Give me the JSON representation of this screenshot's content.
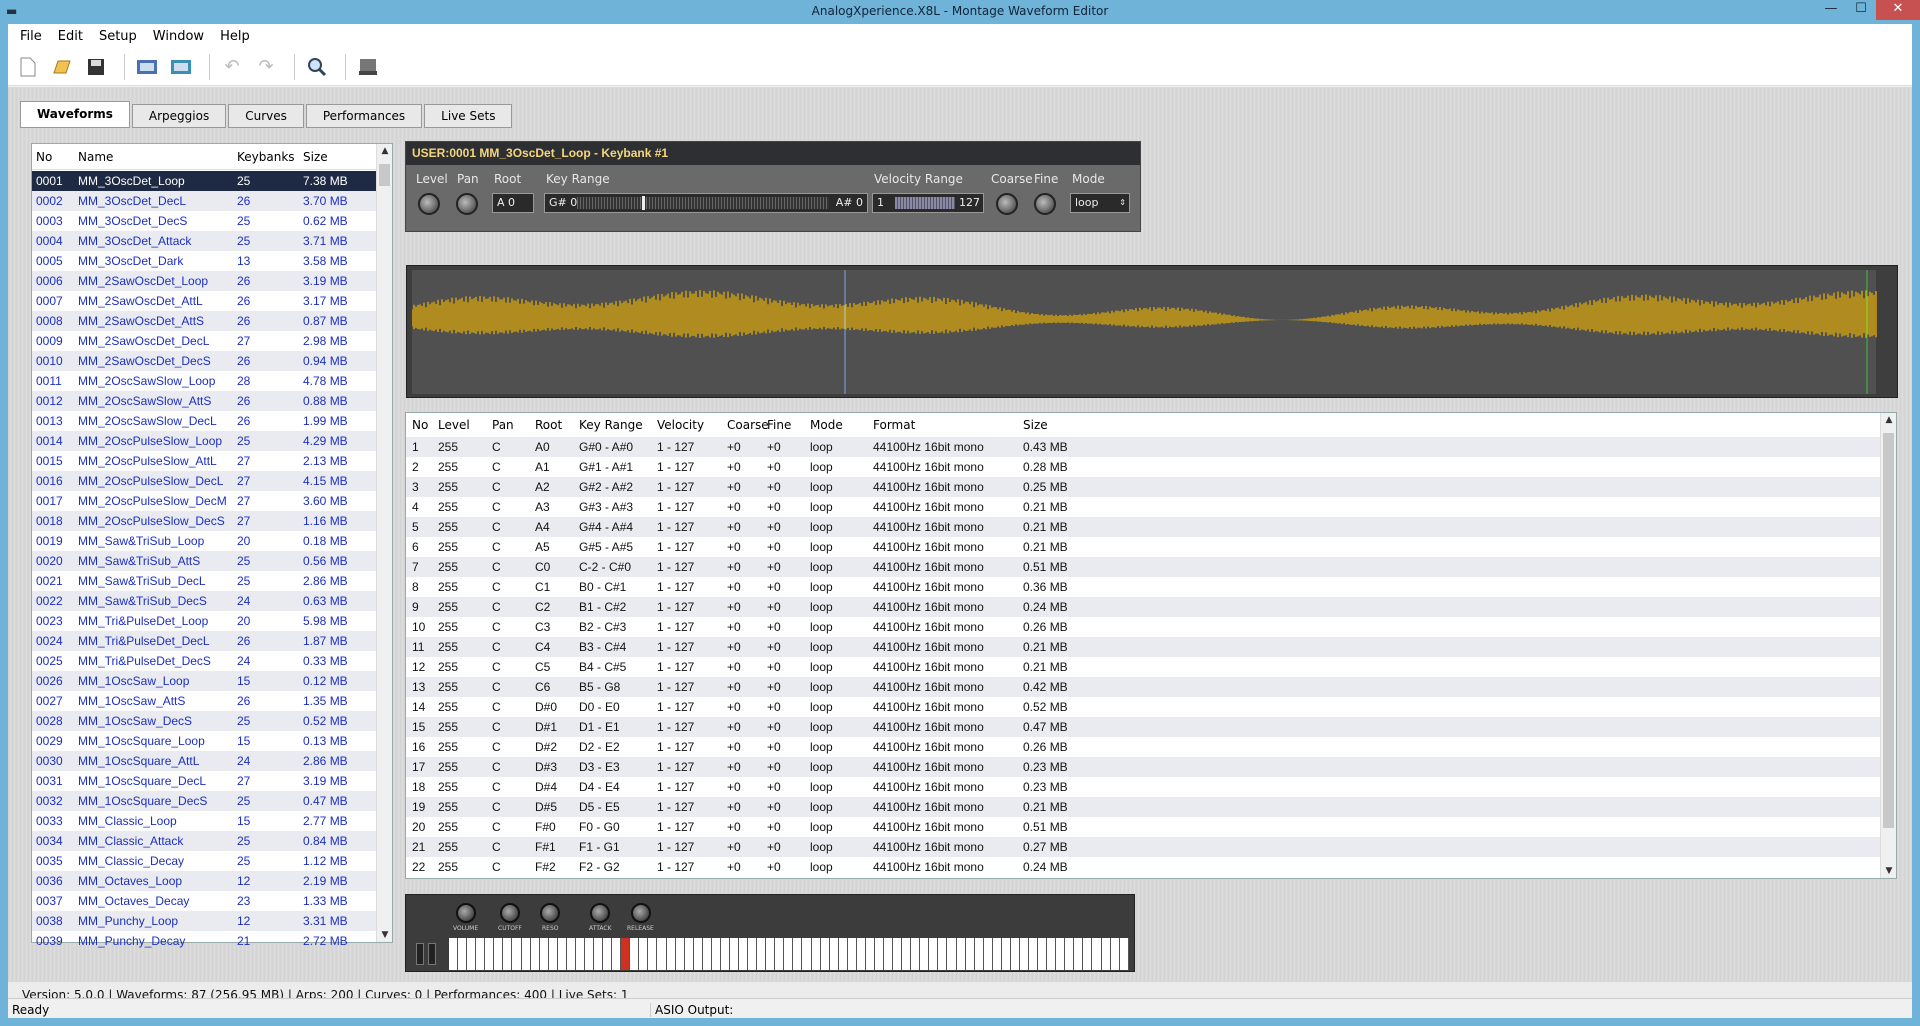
{
  "window": {
    "title": "AnalogXperience.X8L - Montage Waveform Editor",
    "minimize": "—",
    "maximize": "☐",
    "close": "✕"
  },
  "menu": [
    "File",
    "Edit",
    "Setup",
    "Window",
    "Help"
  ],
  "toolbar": {
    "icons": [
      "new-file-icon",
      "open-file-icon",
      "save-icon",
      "import-icon",
      "export-icon",
      "undo-icon",
      "redo-icon",
      "search-icon",
      "device-icon"
    ]
  },
  "tabs": [
    "Waveforms",
    "Arpeggios",
    "Curves",
    "Performances",
    "Live Sets"
  ],
  "waveform_list": {
    "headers": {
      "no": "No",
      "name": "Name",
      "keybanks": "Keybanks",
      "size": "Size"
    },
    "rows": [
      [
        "0001",
        "MM_3OscDet_Loop",
        "25",
        "7.38 MB"
      ],
      [
        "0002",
        "MM_3OscDet_DecL",
        "26",
        "3.70 MB"
      ],
      [
        "0003",
        "MM_3OscDet_DecS",
        "25",
        "0.62 MB"
      ],
      [
        "0004",
        "MM_3OscDet_Attack",
        "25",
        "3.71 MB"
      ],
      [
        "0005",
        "MM_3OscDet_Dark",
        "13",
        "3.58 MB"
      ],
      [
        "0006",
        "MM_2SawOscDet_Loop",
        "26",
        "3.19 MB"
      ],
      [
        "0007",
        "MM_2SawOscDet_AttL",
        "26",
        "3.17 MB"
      ],
      [
        "0008",
        "MM_2SawOscDet_AttS",
        "26",
        "0.87 MB"
      ],
      [
        "0009",
        "MM_2SawOscDet_DecL",
        "27",
        "2.98 MB"
      ],
      [
        "0010",
        "MM_2SawOscDet_DecS",
        "26",
        "0.94 MB"
      ],
      [
        "0011",
        "MM_2OscSawSlow_Loop",
        "28",
        "4.78 MB"
      ],
      [
        "0012",
        "MM_2OscSawSlow_AttS",
        "26",
        "0.88 MB"
      ],
      [
        "0013",
        "MM_2OscSawSlow_DecL",
        "26",
        "1.99 MB"
      ],
      [
        "0014",
        "MM_2OscPulseSlow_Loop",
        "25",
        "4.29 MB"
      ],
      [
        "0015",
        "MM_2OscPulseSlow_AttL",
        "27",
        "2.13 MB"
      ],
      [
        "0016",
        "MM_2OscPulseSlow_DecL",
        "27",
        "4.15 MB"
      ],
      [
        "0017",
        "MM_2OscPulseSlow_DecM",
        "27",
        "3.60 MB"
      ],
      [
        "0018",
        "MM_2OscPulseSlow_DecS",
        "27",
        "1.16 MB"
      ],
      [
        "0019",
        "MM_Saw&TriSub_Loop",
        "20",
        "0.18 MB"
      ],
      [
        "0020",
        "MM_Saw&TriSub_AttS",
        "25",
        "0.56 MB"
      ],
      [
        "0021",
        "MM_Saw&TriSub_DecL",
        "25",
        "2.86 MB"
      ],
      [
        "0022",
        "MM_Saw&TriSub_DecS",
        "24",
        "0.63 MB"
      ],
      [
        "0023",
        "MM_Tri&PulseDet_Loop",
        "20",
        "5.98 MB"
      ],
      [
        "0024",
        "MM_Tri&PulseDet_DecL",
        "26",
        "1.87 MB"
      ],
      [
        "0025",
        "MM_Tri&PulseDet_DecS",
        "24",
        "0.33 MB"
      ],
      [
        "0026",
        "MM_1OscSaw_Loop",
        "15",
        "0.12 MB"
      ],
      [
        "0027",
        "MM_1OscSaw_AttS",
        "26",
        "1.35 MB"
      ],
      [
        "0028",
        "MM_1OscSaw_DecS",
        "25",
        "0.52 MB"
      ],
      [
        "0029",
        "MM_1OscSquare_Loop",
        "15",
        "0.13 MB"
      ],
      [
        "0030",
        "MM_1OscSquare_AttL",
        "24",
        "2.86 MB"
      ],
      [
        "0031",
        "MM_1OscSquare_DecL",
        "27",
        "3.19 MB"
      ],
      [
        "0032",
        "MM_1OscSquare_DecS",
        "25",
        "0.47 MB"
      ],
      [
        "0033",
        "MM_Classic_Loop",
        "15",
        "2.77 MB"
      ],
      [
        "0034",
        "MM_Classic_Attack",
        "25",
        "0.84 MB"
      ],
      [
        "0035",
        "MM_Classic_Decay",
        "25",
        "1.12 MB"
      ],
      [
        "0036",
        "MM_Octaves_Loop",
        "12",
        "2.19 MB"
      ],
      [
        "0037",
        "MM_Octaves_Decay",
        "23",
        "1.33 MB"
      ],
      [
        "0038",
        "MM_Punchy_Loop",
        "12",
        "3.31 MB"
      ],
      [
        "0039",
        "MM_Punchy_Decay",
        "21",
        "2.72 MB"
      ]
    ]
  },
  "keybank_header": {
    "title": "USER:0001 MM_3OscDet_Loop - Keybank #1",
    "labels": {
      "level": "Level",
      "pan": "Pan",
      "root": "Root",
      "key_range": "Key Range",
      "velocity_range": "Velocity Range",
      "coarse": "Coarse",
      "fine": "Fine",
      "mode": "Mode"
    },
    "values": {
      "root": "A 0",
      "key_low": "G# 0",
      "key_high": "A# 0",
      "vel_low": "1",
      "vel_high": "127",
      "mode": "loop"
    }
  },
  "keybank_table": {
    "headers": {
      "no": "No",
      "level": "Level",
      "pan": "Pan",
      "root": "Root",
      "key_range": "Key Range",
      "velocity": "Velocity",
      "coarse": "Coarse",
      "fine": "Fine",
      "mode": "Mode",
      "format": "Format",
      "size": "Size"
    },
    "rows": [
      [
        "1",
        "255",
        "C",
        "A0",
        "G#0 - A#0",
        "1 - 127",
        "+0",
        "+0",
        "loop",
        "44100Hz  16bit  mono",
        "0.43 MB"
      ],
      [
        "2",
        "255",
        "C",
        "A1",
        "G#1 - A#1",
        "1 - 127",
        "+0",
        "+0",
        "loop",
        "44100Hz  16bit  mono",
        "0.28 MB"
      ],
      [
        "3",
        "255",
        "C",
        "A2",
        "G#2 - A#2",
        "1 - 127",
        "+0",
        "+0",
        "loop",
        "44100Hz  16bit  mono",
        "0.25 MB"
      ],
      [
        "4",
        "255",
        "C",
        "A3",
        "G#3 - A#3",
        "1 - 127",
        "+0",
        "+0",
        "loop",
        "44100Hz  16bit  mono",
        "0.21 MB"
      ],
      [
        "5",
        "255",
        "C",
        "A4",
        "G#4 - A#4",
        "1 - 127",
        "+0",
        "+0",
        "loop",
        "44100Hz  16bit  mono",
        "0.21 MB"
      ],
      [
        "6",
        "255",
        "C",
        "A5",
        "G#5 - A#5",
        "1 - 127",
        "+0",
        "+0",
        "loop",
        "44100Hz  16bit  mono",
        "0.21 MB"
      ],
      [
        "7",
        "255",
        "C",
        "C0",
        "C-2 - C#0",
        "1 - 127",
        "+0",
        "+0",
        "loop",
        "44100Hz  16bit  mono",
        "0.51 MB"
      ],
      [
        "8",
        "255",
        "C",
        "C1",
        "B0 - C#1",
        "1 - 127",
        "+0",
        "+0",
        "loop",
        "44100Hz  16bit  mono",
        "0.36 MB"
      ],
      [
        "9",
        "255",
        "C",
        "C2",
        "B1 - C#2",
        "1 - 127",
        "+0",
        "+0",
        "loop",
        "44100Hz  16bit  mono",
        "0.24 MB"
      ],
      [
        "10",
        "255",
        "C",
        "C3",
        "B2 - C#3",
        "1 - 127",
        "+0",
        "+0",
        "loop",
        "44100Hz  16bit  mono",
        "0.26 MB"
      ],
      [
        "11",
        "255",
        "C",
        "C4",
        "B3 - C#4",
        "1 - 127",
        "+0",
        "+0",
        "loop",
        "44100Hz  16bit  mono",
        "0.21 MB"
      ],
      [
        "12",
        "255",
        "C",
        "C5",
        "B4 - C#5",
        "1 - 127",
        "+0",
        "+0",
        "loop",
        "44100Hz  16bit  mono",
        "0.21 MB"
      ],
      [
        "13",
        "255",
        "C",
        "C6",
        "B5 - G8",
        "1 - 127",
        "+0",
        "+0",
        "loop",
        "44100Hz  16bit  mono",
        "0.42 MB"
      ],
      [
        "14",
        "255",
        "C",
        "D#0",
        "D0 - E0",
        "1 - 127",
        "+0",
        "+0",
        "loop",
        "44100Hz  16bit  mono",
        "0.52 MB"
      ],
      [
        "15",
        "255",
        "C",
        "D#1",
        "D1 - E1",
        "1 - 127",
        "+0",
        "+0",
        "loop",
        "44100Hz  16bit  mono",
        "0.47 MB"
      ],
      [
        "16",
        "255",
        "C",
        "D#2",
        "D2 - E2",
        "1 - 127",
        "+0",
        "+0",
        "loop",
        "44100Hz  16bit  mono",
        "0.26 MB"
      ],
      [
        "17",
        "255",
        "C",
        "D#3",
        "D3 - E3",
        "1 - 127",
        "+0",
        "+0",
        "loop",
        "44100Hz  16bit  mono",
        "0.23 MB"
      ],
      [
        "18",
        "255",
        "C",
        "D#4",
        "D4 - E4",
        "1 - 127",
        "+0",
        "+0",
        "loop",
        "44100Hz  16bit  mono",
        "0.23 MB"
      ],
      [
        "19",
        "255",
        "C",
        "D#5",
        "D5 - E5",
        "1 - 127",
        "+0",
        "+0",
        "loop",
        "44100Hz  16bit  mono",
        "0.21 MB"
      ],
      [
        "20",
        "255",
        "C",
        "F#0",
        "F0 - G0",
        "1 - 127",
        "+0",
        "+0",
        "loop",
        "44100Hz  16bit  mono",
        "0.51 MB"
      ],
      [
        "21",
        "255",
        "C",
        "F#1",
        "F1 - G1",
        "1 - 127",
        "+0",
        "+0",
        "loop",
        "44100Hz  16bit  mono",
        "0.27 MB"
      ],
      [
        "22",
        "255",
        "C",
        "F#2",
        "F2 - G2",
        "1 - 127",
        "+0",
        "+0",
        "loop",
        "44100Hz  16bit  mono",
        "0.24 MB"
      ]
    ]
  },
  "keyboard": {
    "knobs": [
      "VOLUME",
      "CUTOFF",
      "RESO",
      "ATTACK",
      "RELEASE"
    ]
  },
  "status_info": "Version: 5.0.0   |   Waveforms: 87 (256.95 MB)   |   Arps: 200   |   Curves: 0   |   Performances: 400   |   Live Sets: 1",
  "statusbar": {
    "left": "Ready",
    "right": "ASIO Output:"
  },
  "colors": {
    "waveform": "#f0b400",
    "selected_row": "#1e2a44",
    "list_text": "#1c2fbf"
  }
}
